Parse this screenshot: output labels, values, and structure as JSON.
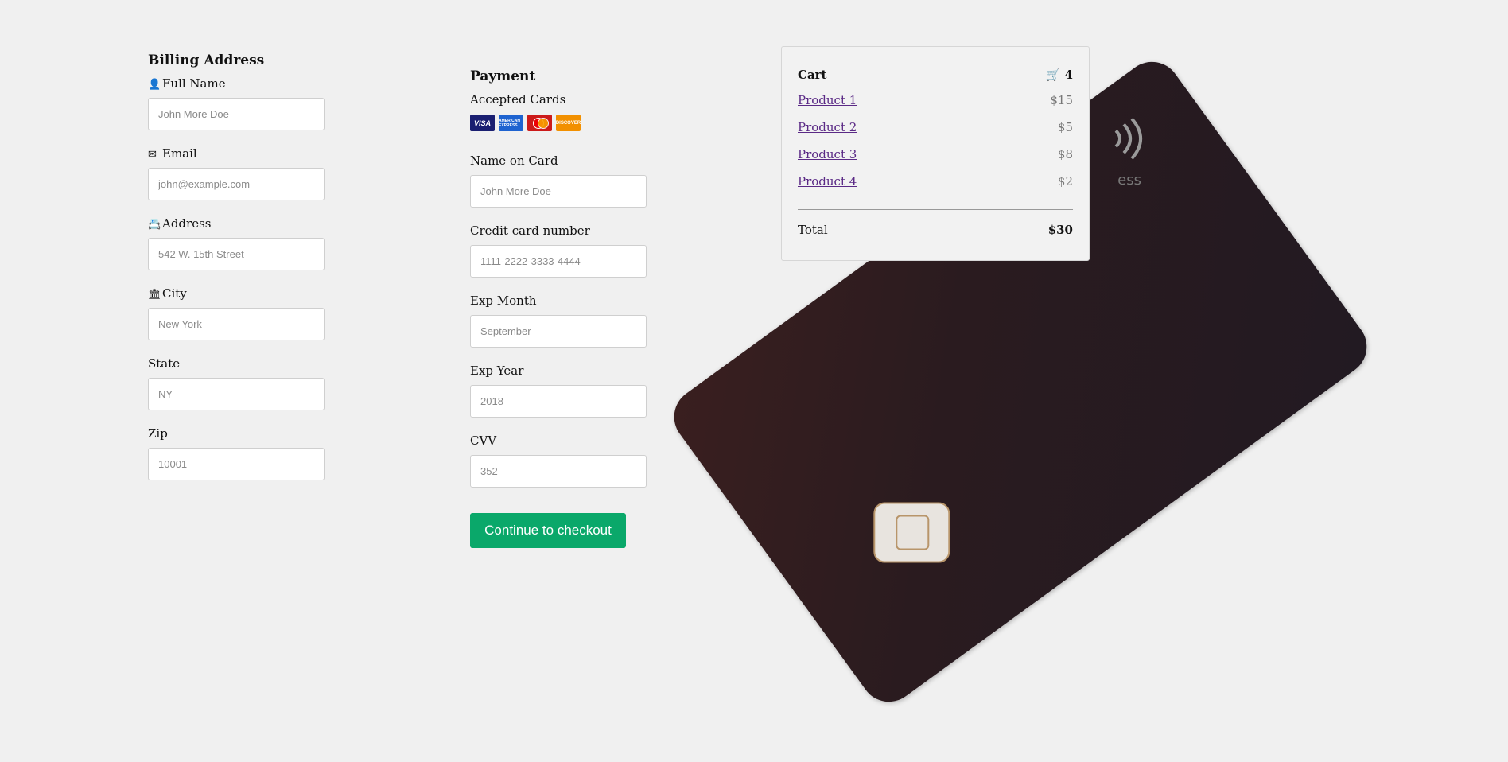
{
  "billing": {
    "heading": "Billing Address",
    "full_name": {
      "label": "Full Name",
      "placeholder": "John More Doe"
    },
    "email": {
      "label": "Email",
      "placeholder": "john@example.com"
    },
    "address": {
      "label": "Address",
      "placeholder": "542 W. 15th Street"
    },
    "city": {
      "label": "City",
      "placeholder": "New York"
    },
    "state": {
      "label": "State",
      "placeholder": "NY"
    },
    "zip": {
      "label": "Zip",
      "placeholder": "10001"
    }
  },
  "payment": {
    "heading": "Payment",
    "accepted_label": "Accepted Cards",
    "cards": [
      "VISA",
      "AMERICAN EXPRESS",
      "MASTERCARD",
      "DISCOVER"
    ],
    "name_on_card": {
      "label": "Name on Card",
      "placeholder": "John More Doe"
    },
    "card_number": {
      "label": "Credit card number",
      "placeholder": "1111-2222-3333-4444"
    },
    "exp_month": {
      "label": "Exp Month",
      "placeholder": "September"
    },
    "exp_year": {
      "label": "Exp Year",
      "placeholder": "2018"
    },
    "cvv": {
      "label": "CVV",
      "placeholder": "352"
    },
    "submit_label": "Continue to checkout"
  },
  "cart": {
    "title": "Cart",
    "count": "4",
    "items": [
      {
        "name": "Product 1",
        "price": "$15"
      },
      {
        "name": "Product 2",
        "price": "$5"
      },
      {
        "name": "Product 3",
        "price": "$8"
      },
      {
        "name": "Product 4",
        "price": "$2"
      }
    ],
    "total_label": "Total",
    "total_value": "$30"
  },
  "background": {
    "brand_text": "ess"
  },
  "colors": {
    "accent": "#0aa86a",
    "link": "#5b2a86",
    "card": "#2a1b1f"
  }
}
